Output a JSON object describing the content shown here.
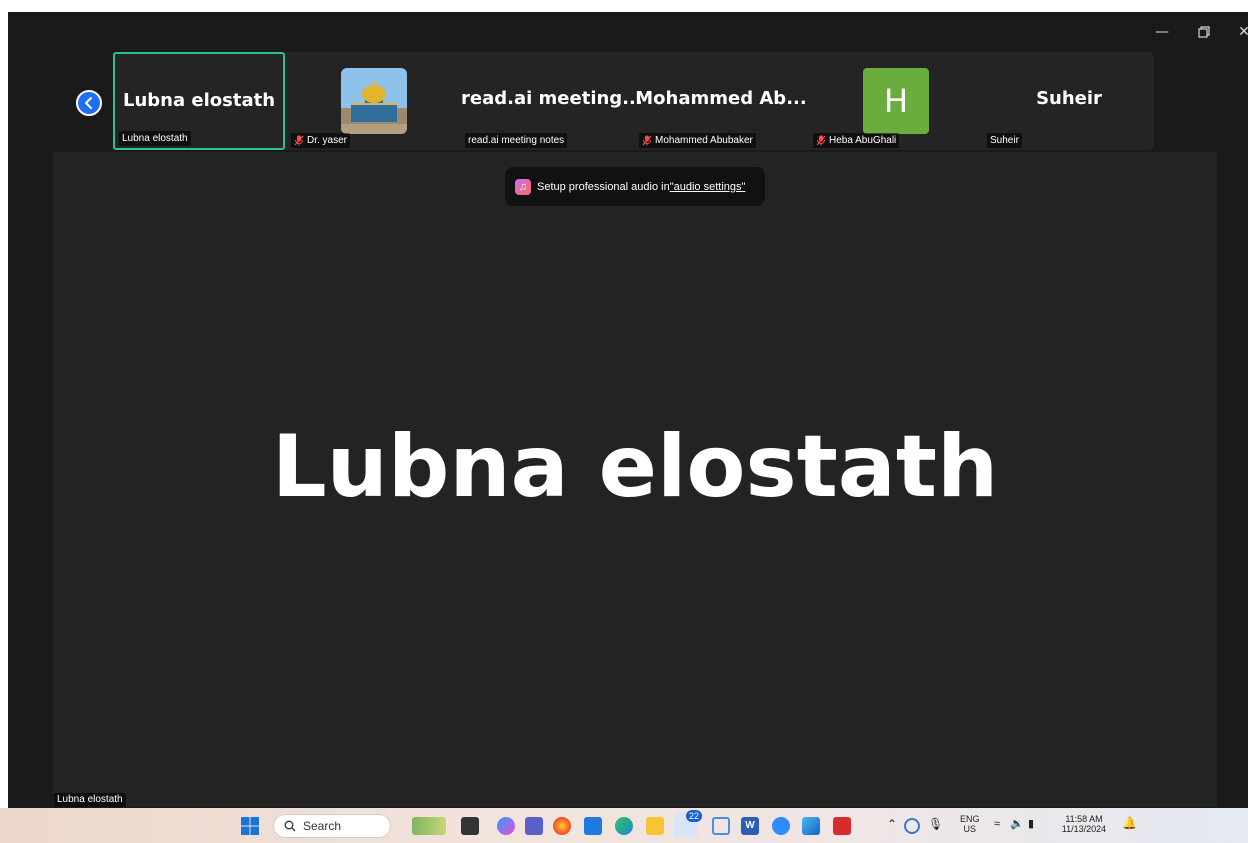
{
  "participants": [
    {
      "display": "Lubna elostath",
      "tag": "Lubna elostath",
      "muted": false,
      "active": true,
      "avatar": "none"
    },
    {
      "display": "",
      "tag": "Dr. yaser",
      "muted": true,
      "active": false,
      "avatar": "dome-of-rock-photo"
    },
    {
      "display": "read.ai  meeting...",
      "tag": "read.ai meeting notes",
      "muted": false,
      "active": false,
      "avatar": "none"
    },
    {
      "display": "Mohammed  Ab...",
      "tag": "Mohammed Abubaker",
      "muted": true,
      "active": false,
      "avatar": "none"
    },
    {
      "display": "H",
      "tag": "Heba AbuGhali",
      "muted": true,
      "active": false,
      "avatar": "letter-tile"
    },
    {
      "display": "Suheir",
      "tag": "Suheir",
      "muted": false,
      "active": false,
      "avatar": "none"
    }
  ],
  "main": {
    "speaker_display": "Lubna elostath",
    "speaker_tag": "Lubna elostath"
  },
  "toast": {
    "text": "Setup professional audio in ",
    "link": "\"audio settings\""
  },
  "taskbar": {
    "search_placeholder": "Search",
    "badge_count": "22",
    "lang_top": "ENG",
    "lang_bottom": "US",
    "time": "11:58 AM",
    "date": "11/13/2024"
  },
  "colors": {
    "active_border": "#2bc485",
    "letter_avatar": "#6aad3d",
    "collapse_button": "#1e6ff5"
  }
}
